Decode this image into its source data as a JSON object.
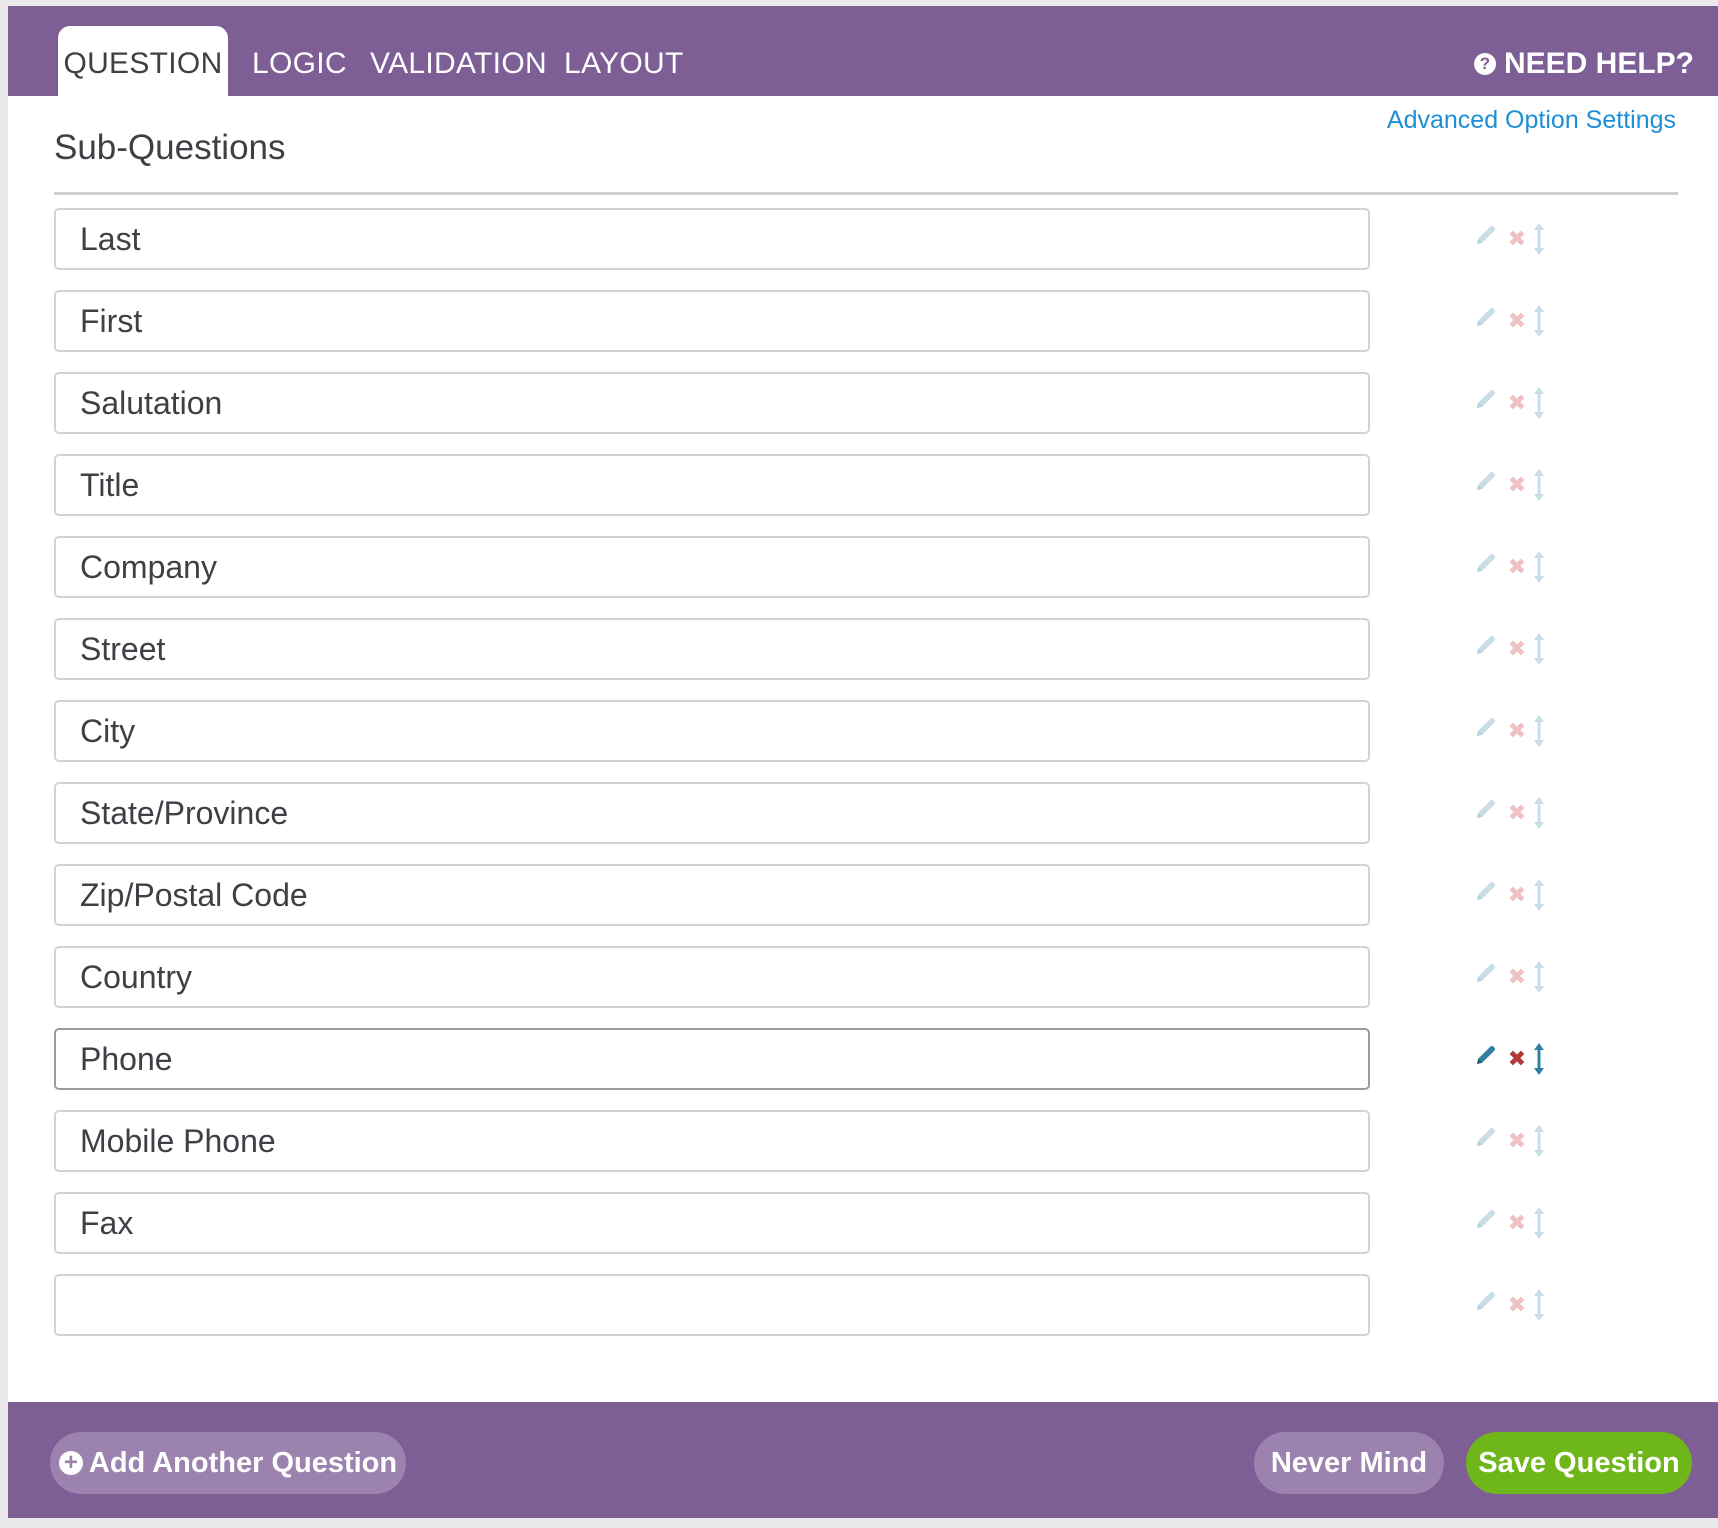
{
  "tabs": [
    {
      "label": "QUESTION",
      "active": true
    },
    {
      "label": "LOGIC",
      "active": false
    },
    {
      "label": "VALIDATION",
      "active": false
    },
    {
      "label": "LAYOUT",
      "active": false
    }
  ],
  "help": {
    "label": "NEED HELP?",
    "icon": "question-circle-icon"
  },
  "advanced_link": "Advanced Option Settings",
  "section_title": "Sub-Questions",
  "sub_questions": [
    {
      "value": "Last"
    },
    {
      "value": "First"
    },
    {
      "value": "Salutation"
    },
    {
      "value": "Title"
    },
    {
      "value": "Company"
    },
    {
      "value": "Street"
    },
    {
      "value": "City"
    },
    {
      "value": "State/Province"
    },
    {
      "value": "Zip/Postal Code"
    },
    {
      "value": "Country"
    },
    {
      "value": "Phone",
      "hovered": true
    },
    {
      "value": "Mobile Phone"
    },
    {
      "value": "Fax"
    },
    {
      "value": ""
    }
  ],
  "row_action_icons": [
    "pencil-icon",
    "delete-x-icon",
    "move-updown-icon"
  ],
  "footer": {
    "add_label": "Add Another Question",
    "never_label": "Never Mind",
    "save_label": "Save Question"
  },
  "colors": {
    "brand_purple": "#7e5f95",
    "button_purple": "#9b82af",
    "save_green": "#6eb61a",
    "link_blue": "#1d8fd6",
    "edit_active": "#2f7fa0",
    "delete_active": "#b03a3a"
  }
}
